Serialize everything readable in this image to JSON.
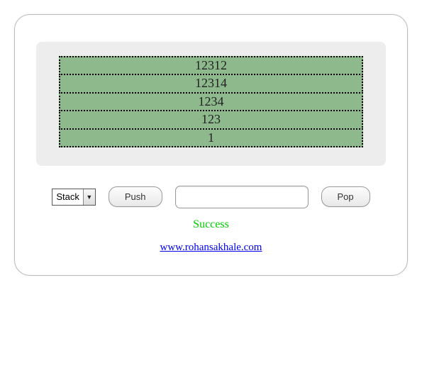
{
  "stack": {
    "items": [
      "12312",
      "12314",
      "1234",
      "123",
      "1"
    ]
  },
  "controls": {
    "mode_selected": "Stack",
    "push_label": "Push",
    "pop_label": "Pop",
    "input_value": ""
  },
  "status": {
    "message": "Success"
  },
  "footer": {
    "link_text": "www.rohansakhale.com"
  }
}
